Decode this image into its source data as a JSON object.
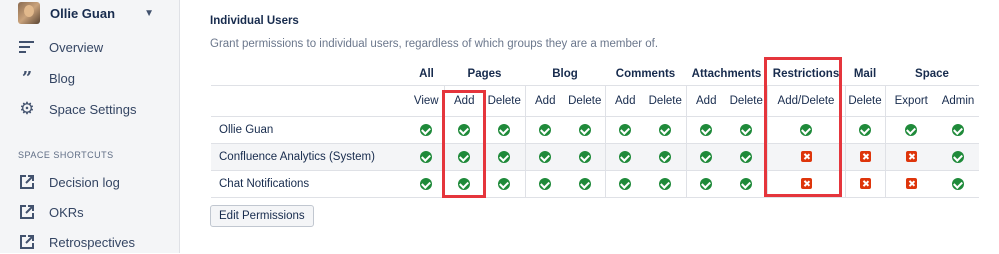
{
  "sidebar": {
    "user": "Ollie Guan",
    "items": [
      {
        "label": "Overview",
        "icon": "overview-icon"
      },
      {
        "label": "Blog",
        "icon": "quote-icon"
      },
      {
        "label": "Space Settings",
        "icon": "gear-icon"
      }
    ],
    "shortcuts_title": "SPACE SHORTCUTS",
    "shortcuts": [
      {
        "label": "Decision log",
        "icon": "external-link-icon"
      },
      {
        "label": "OKRs",
        "icon": "external-link-icon"
      },
      {
        "label": "Retrospectives",
        "icon": "external-link-icon"
      }
    ]
  },
  "main": {
    "title": "Individual Users",
    "description": "Grant permissions to individual users, regardless of which groups they are a member of.",
    "groups": [
      "All",
      "Pages",
      "Blog",
      "Comments",
      "Attachments",
      "Restrictions",
      "Mail",
      "Space"
    ],
    "operations": [
      "View",
      "Add",
      "Delete",
      "Add",
      "Delete",
      "Add",
      "Delete",
      "Add",
      "Delete",
      "Add/Delete",
      "Delete",
      "Export",
      "Admin"
    ],
    "rows": [
      {
        "name": "Ollie Guan",
        "perms": [
          true,
          true,
          true,
          true,
          true,
          true,
          true,
          true,
          true,
          true,
          true,
          true,
          true
        ]
      },
      {
        "name": "Confluence Analytics (System)",
        "perms": [
          true,
          true,
          true,
          true,
          true,
          true,
          true,
          true,
          true,
          false,
          false,
          false,
          true
        ]
      },
      {
        "name": "Chat Notifications",
        "perms": [
          true,
          true,
          true,
          true,
          true,
          true,
          true,
          true,
          true,
          false,
          false,
          false,
          true
        ]
      }
    ],
    "edit_button": "Edit Permissions"
  },
  "colors": {
    "granted": "#1f8a3a",
    "denied": "#de350b",
    "highlight": "#e5353c"
  }
}
